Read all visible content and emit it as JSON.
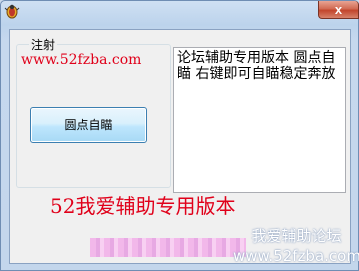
{
  "window": {
    "close_glyph": "x",
    "icon": "app-bug-icon"
  },
  "group": {
    "title": "注射"
  },
  "site_link": "www.52fzba.com",
  "aim_button_label": "圆点自瞄",
  "notes_text": "论坛辅助专用版本 圆点自瞄 右键即可自瞄稳定奔放",
  "banner_text": "52我爱辅助专用版本",
  "watermark": {
    "line1": "我爱辅助论坛",
    "line2": "www.52fzba.com"
  },
  "colors": {
    "accent_red": "#e0001a",
    "button_blue": "#3c7fb1"
  }
}
